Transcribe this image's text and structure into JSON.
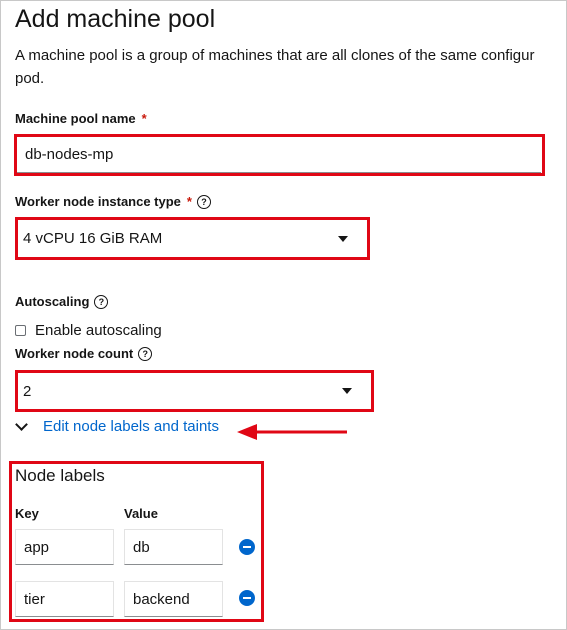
{
  "page": {
    "title": "Add machine pool",
    "description_line1": "A machine pool is a group of machines that are all clones of the same configur",
    "description_line2": "pod."
  },
  "machine_pool_name": {
    "label": "Machine pool name",
    "required_mark": "*",
    "value": "db-nodes-mp"
  },
  "instance_type": {
    "label": "Worker node instance type",
    "required_mark": "*",
    "help_icon": "question-circle-icon",
    "selected": "4 vCPU 16 GiB RAM"
  },
  "autoscaling": {
    "label": "Autoscaling",
    "help_icon": "question-circle-icon",
    "checkbox_label": "Enable autoscaling",
    "checked": false
  },
  "node_count": {
    "label": "Worker node count",
    "help_icon": "question-circle-icon",
    "selected": "2"
  },
  "expand_section": {
    "label": "Edit node labels and taints",
    "icon": "chevron-down-icon",
    "link_color": "#0066cc"
  },
  "node_labels": {
    "title": "Node labels",
    "key_header": "Key",
    "value_header": "Value",
    "rows": [
      {
        "key": "app",
        "value": "db"
      },
      {
        "key": "tier",
        "value": "backend"
      }
    ],
    "remove_icon": "minus-circle-icon"
  },
  "colors": {
    "highlight": "#e00715",
    "required": "#c9190b",
    "accent": "#0066cc"
  }
}
